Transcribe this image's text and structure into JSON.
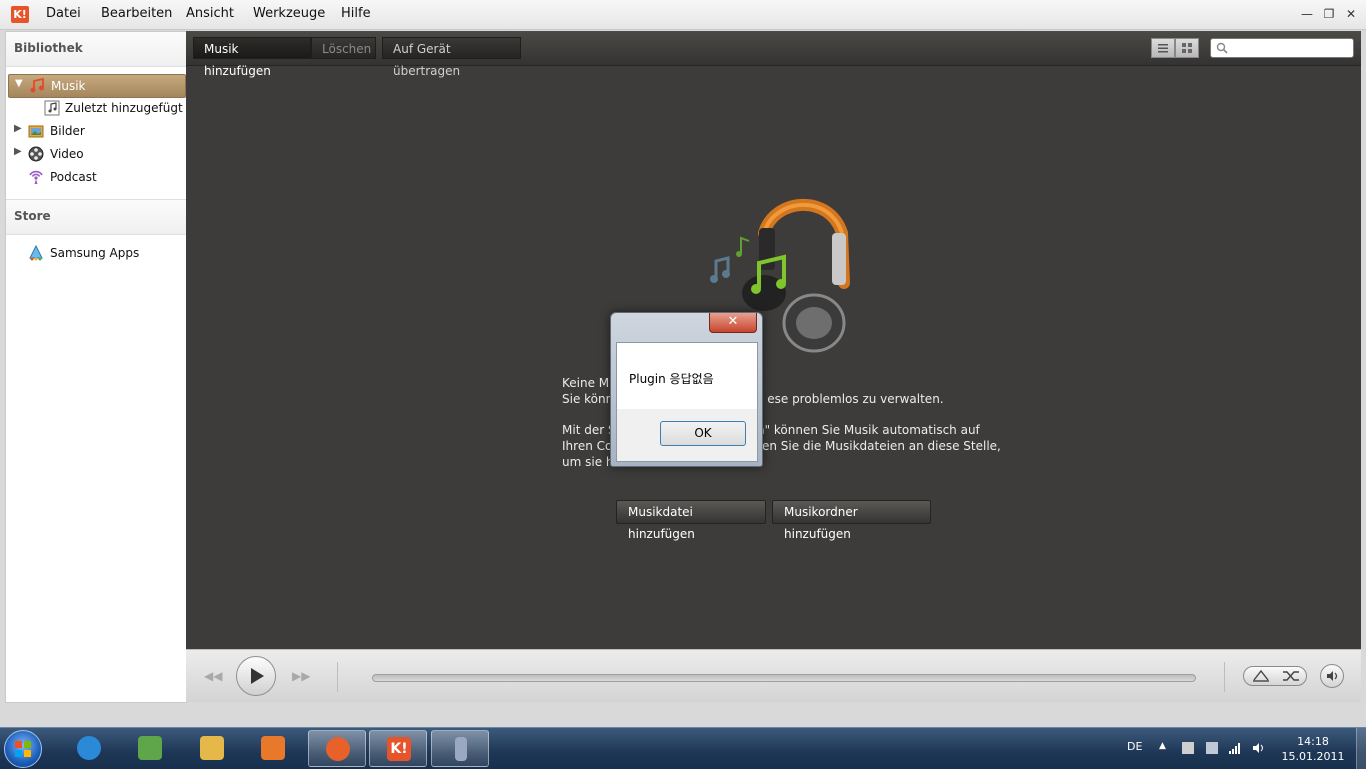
{
  "menu": {
    "logo_text": "K!",
    "items": [
      "Datei",
      "Bearbeiten",
      "Ansicht",
      "Werkzeuge",
      "Hilfe"
    ]
  },
  "sidebar": {
    "library_header": "Bibliothek",
    "library_items": [
      {
        "label": "Musik",
        "icon": "music-note-icon",
        "expandable": true,
        "selected": true
      },
      {
        "label": "Zuletzt hinzugefügt",
        "icon": "recent-music-icon",
        "expandable": false
      },
      {
        "label": "Bilder",
        "icon": "pictures-folder-icon",
        "expandable": true
      },
      {
        "label": "Video",
        "icon": "film-reel-icon",
        "expandable": true
      },
      {
        "label": "Podcast",
        "icon": "podcast-icon",
        "expandable": false
      }
    ],
    "store_header": "Store",
    "store_items": [
      {
        "label": "Samsung Apps",
        "icon": "samsung-apps-icon"
      }
    ]
  },
  "toolbar": {
    "add_music": "Musik hinzufügen",
    "delete": "Löschen",
    "transfer": "Auf Gerät übertragen",
    "search_placeholder": ""
  },
  "empty_state": {
    "line1": "Keine Mu",
    "line2a": "Sie könn",
    "line2b": "ese problemlos zu verwalten.",
    "para2_line1a": "Mit der S",
    "para2_line1b": "en\" können Sie Musik automatisch auf",
    "para2_line2a": "Ihren Co",
    "para2_line2b": "nen Sie die Musikdateien an diese Stelle,",
    "para2_line3": "um sie h",
    "add_file_button": "Musikdatei hinzufügen",
    "add_folder_button": "Musikordner hinzufügen"
  },
  "dialog": {
    "message": "Plugin 응답없음",
    "ok_label": "OK",
    "close_glyph": "✕"
  },
  "player": {
    "rewind": "◀◀",
    "forward": "▶▶",
    "play": "▶"
  },
  "taskbar": {
    "language": "DE",
    "time": "14:18",
    "date": "15.01.2011",
    "apps": [
      {
        "name": "internet-explorer-icon",
        "color": "#2a8ad8"
      },
      {
        "name": "windows-update-icon",
        "color": "#5fa64a"
      },
      {
        "name": "file-explorer-icon",
        "color": "#e5b84a"
      },
      {
        "name": "media-player-icon",
        "color": "#e8782a"
      },
      {
        "name": "firefox-icon",
        "color": "#e8612a"
      },
      {
        "name": "kies-icon",
        "color": "#e8542a"
      },
      {
        "name": "phone-device-icon",
        "color": "#9aa9c0"
      }
    ]
  },
  "colors": {
    "accent": "#e8542a",
    "main_bg": "#3d3c3a",
    "selection": "#b29368"
  }
}
